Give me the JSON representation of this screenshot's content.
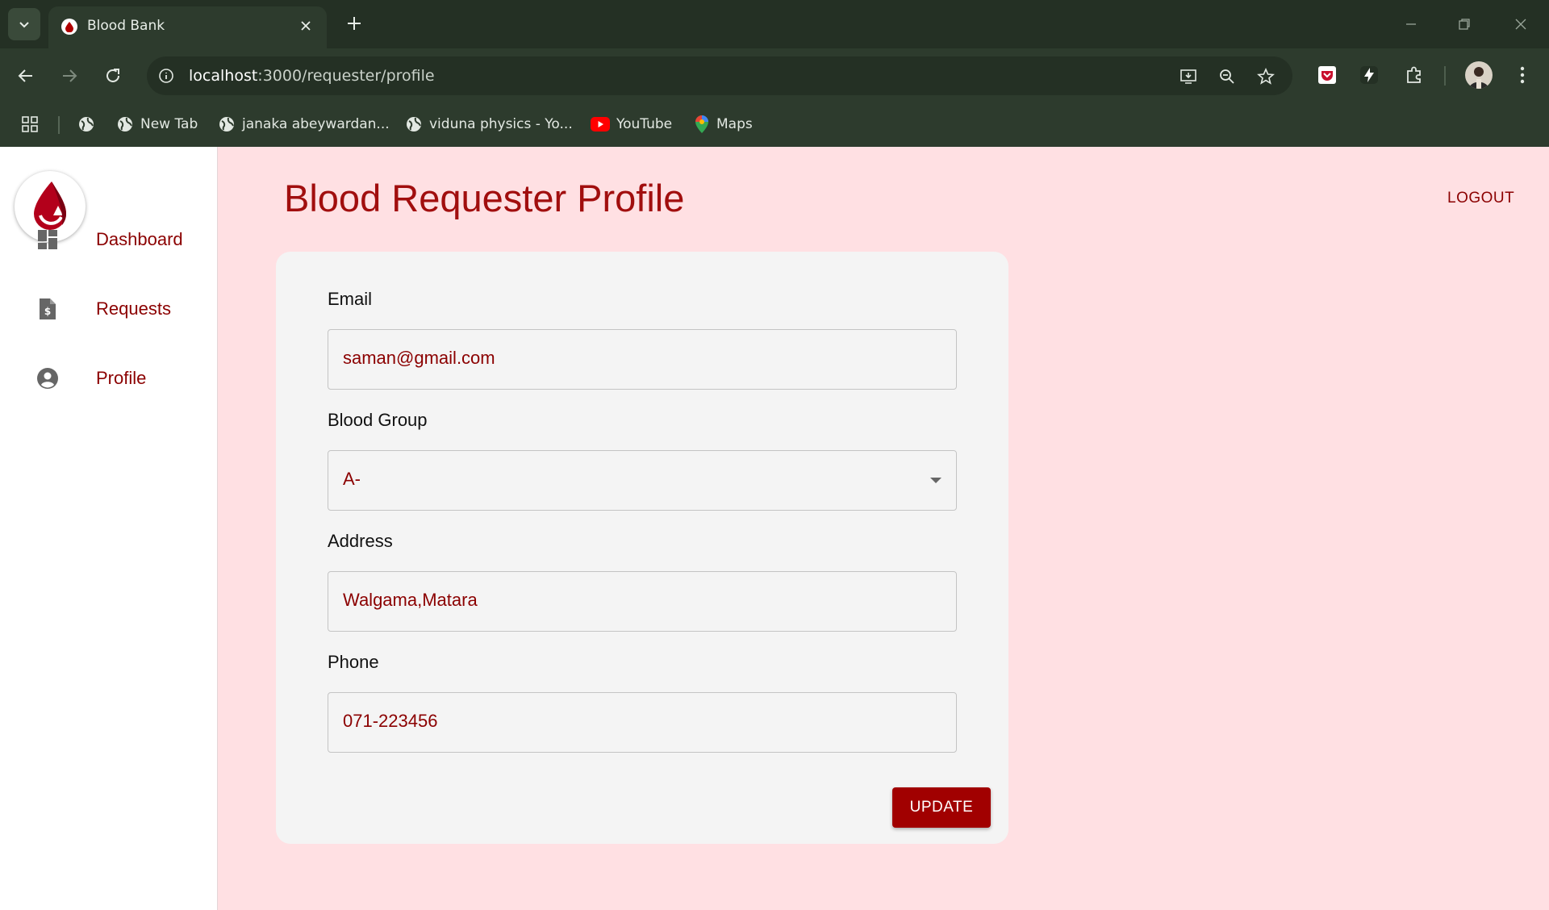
{
  "browser": {
    "tab_title": "Blood Bank",
    "url_host": "localhost",
    "url_path": ":3000/requester/profile",
    "bookmarks": [
      {
        "label": "",
        "icon": "globe-icon"
      },
      {
        "label": "New Tab",
        "icon": "globe-icon"
      },
      {
        "label": "janaka abeywardan...",
        "icon": "globe-icon"
      },
      {
        "label": "viduna physics - Yo...",
        "icon": "globe-icon"
      },
      {
        "label": "YouTube",
        "icon": "youtube-icon"
      },
      {
        "label": "Maps",
        "icon": "maps-icon"
      }
    ]
  },
  "sidebar": {
    "items": [
      {
        "label": "Dashboard",
        "icon": "dashboard-icon"
      },
      {
        "label": "Requests",
        "icon": "request-document-icon"
      },
      {
        "label": "Profile",
        "icon": "account-circle-icon"
      }
    ]
  },
  "header": {
    "title": "Blood Requester Profile",
    "logout_label": "LOGOUT"
  },
  "form": {
    "email_label": "Email",
    "email_value": "saman@gmail.com",
    "blood_group_label": "Blood Group",
    "blood_group_value": "A-",
    "address_label": "Address",
    "address_value": "Walgama,Matara",
    "phone_label": "Phone",
    "phone_value": "071-223456",
    "update_label": "UPDATE"
  },
  "colors": {
    "accent": "#a10000",
    "page_background": "#ffe0e3",
    "chrome": "#2d3b2d"
  }
}
